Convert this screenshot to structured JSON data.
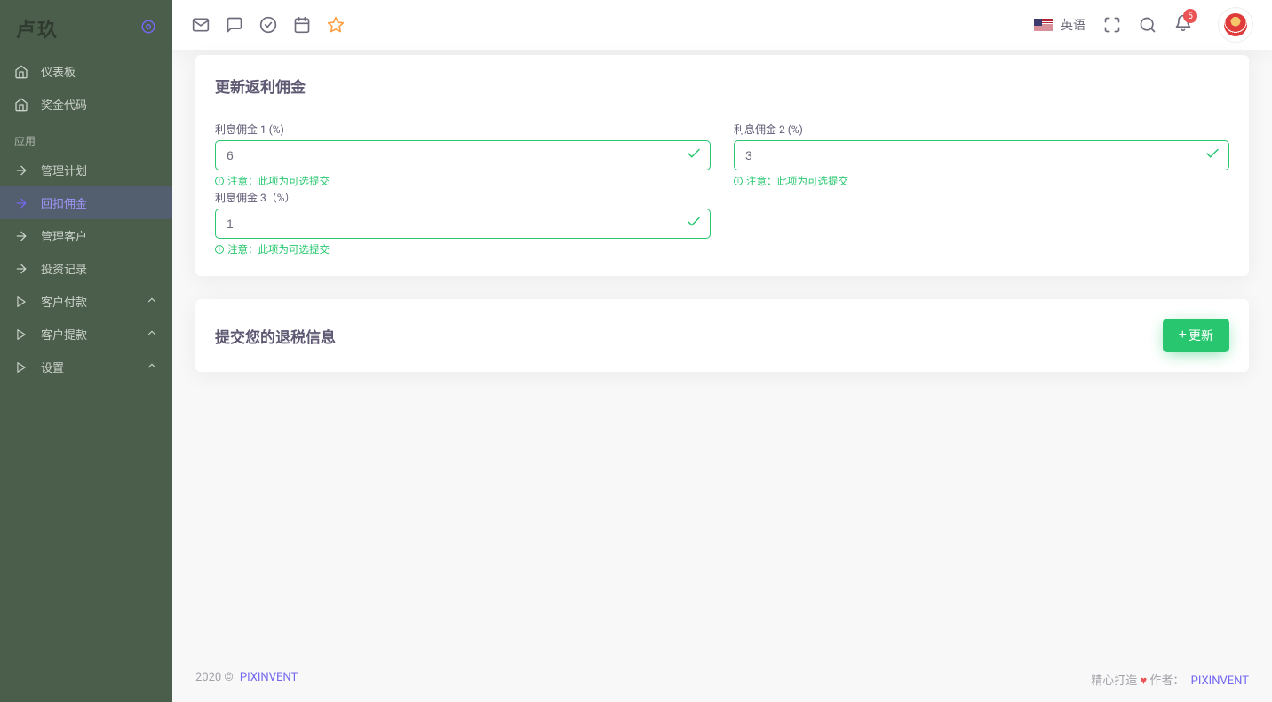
{
  "brand": "卢玖",
  "sidebar": {
    "dashboards": [
      {
        "label": "仪表板"
      },
      {
        "label": "奖金代码"
      }
    ],
    "section_apps": "应用",
    "apps": [
      {
        "label": "管理计划",
        "icon": "arrow-right"
      },
      {
        "label": "回扣佣金",
        "icon": "arrow-right",
        "active": true
      },
      {
        "label": "管理客户",
        "icon": "arrow-right"
      },
      {
        "label": "投资记录",
        "icon": "arrow-right"
      },
      {
        "label": "客户付款",
        "icon": "play",
        "expandable": true
      },
      {
        "label": "客户提款",
        "icon": "play",
        "expandable": true
      },
      {
        "label": "设置",
        "icon": "play",
        "expandable": true
      }
    ]
  },
  "topbar": {
    "language": "英语",
    "notifications_count": "5",
    "user_name": "",
    "user_role": ""
  },
  "card1": {
    "title": "更新返利佣金",
    "fields": {
      "f1": {
        "label": "利息佣金 1 (%)",
        "value": "6",
        "hint": "注意：此项为可选提交"
      },
      "f2": {
        "label": "利息佣金 2 (%)",
        "value": "3",
        "hint": "注意：此项为可选提交"
      },
      "f3": {
        "label": "利息佣金 3（%）",
        "value": "1",
        "hint": "注意：此项为可选提交"
      }
    }
  },
  "card2": {
    "title": "提交您的退税信息",
    "button": "更新"
  },
  "footer": {
    "left_prefix": "2020 ©",
    "left_link": "PIXINVENT",
    "right_made": "精心打造",
    "right_author_label": "作者：",
    "right_author": "PIXINVENT"
  }
}
